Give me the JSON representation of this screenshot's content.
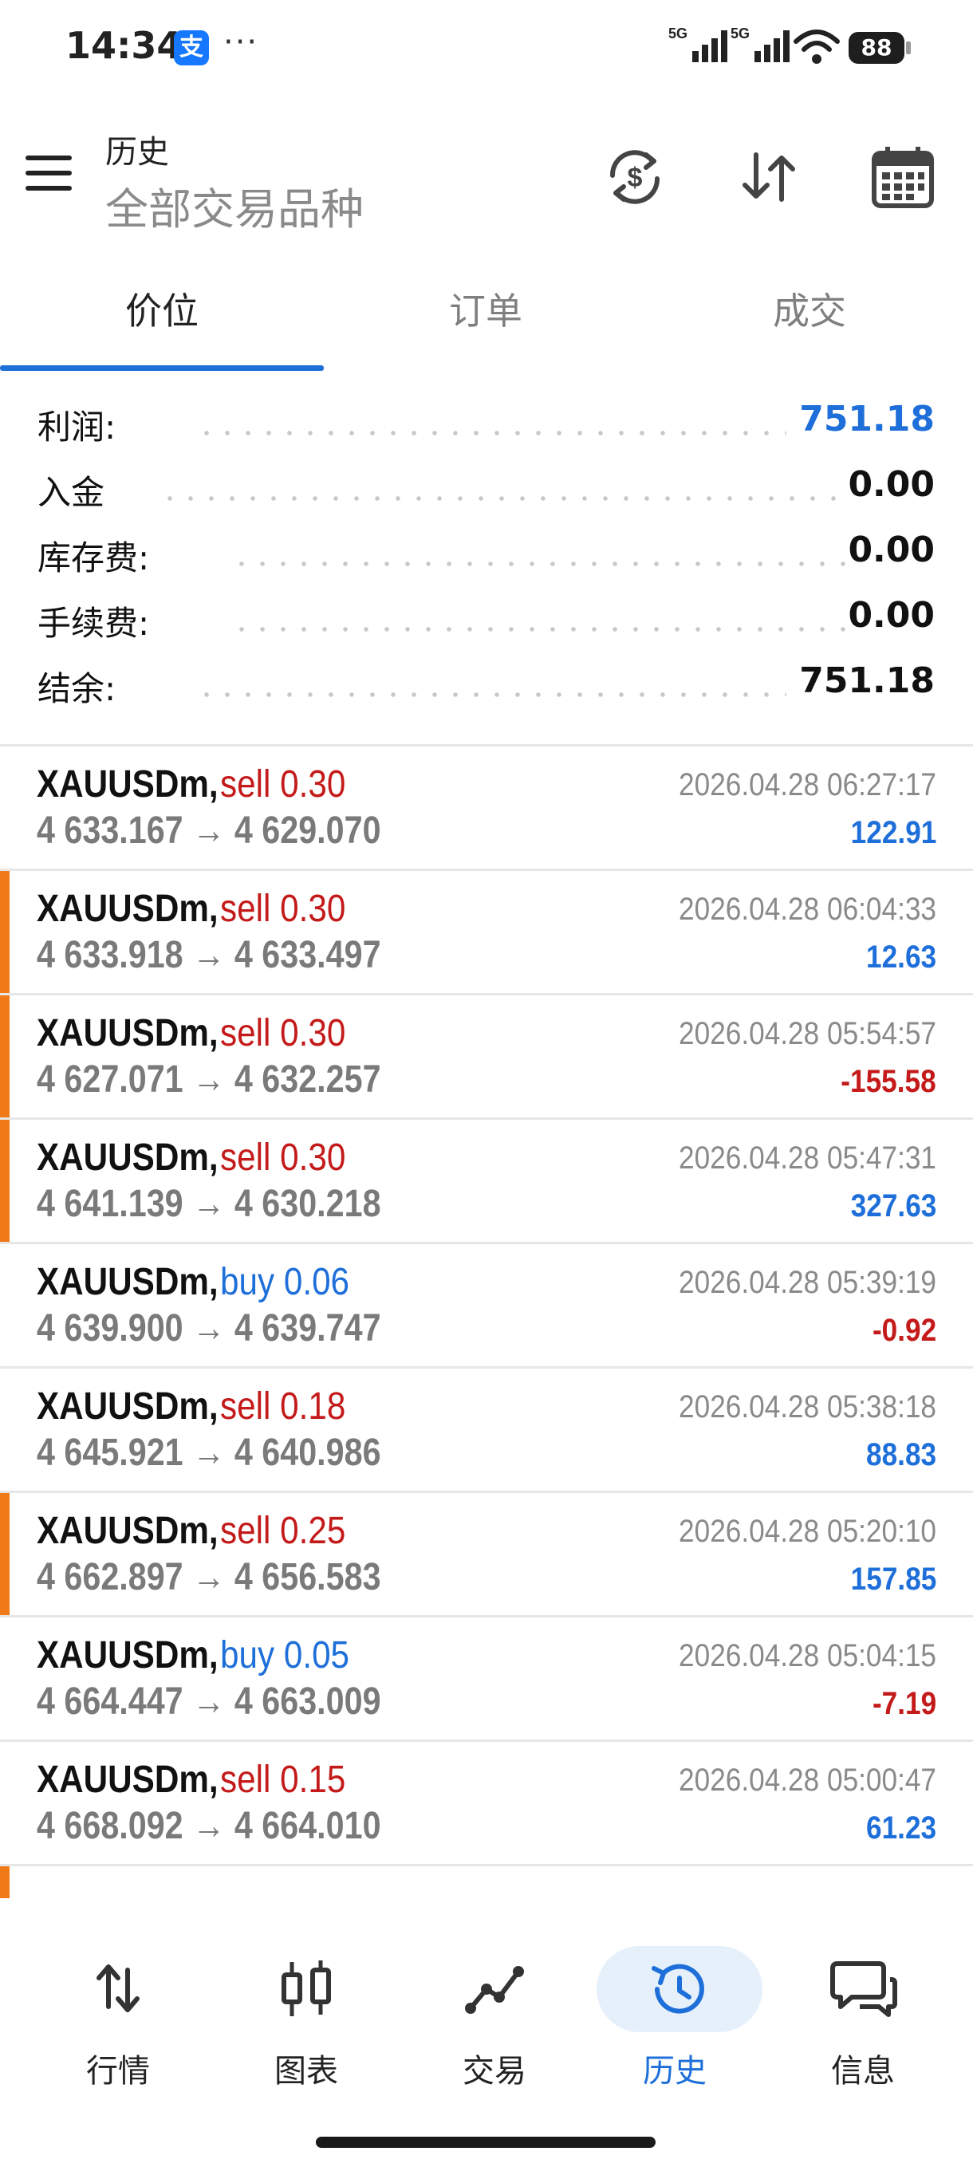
{
  "status_bar": {
    "time": "14:34",
    "alipay_icon_text": "支",
    "more": "···",
    "signal1": "5G",
    "signal2": "5G",
    "battery": "88"
  },
  "app_bar": {
    "title": "历史",
    "subtitle": "全部交易品种",
    "icons": [
      "menu-icon",
      "currency-sync-icon",
      "sort-icon",
      "calendar-icon"
    ]
  },
  "tabs": [
    {
      "label": "价位",
      "active": true
    },
    {
      "label": "订单",
      "active": false
    },
    {
      "label": "成交",
      "active": false
    }
  ],
  "summary": [
    {
      "label": "利润:",
      "value": "751.18",
      "highlight": true
    },
    {
      "label": "入金",
      "value": "0.00",
      "highlight": false
    },
    {
      "label": "库存费:",
      "value": "0.00",
      "highlight": false
    },
    {
      "label": "手续费:",
      "value": "0.00",
      "highlight": false
    },
    {
      "label": "结余:",
      "value": "751.18",
      "highlight": false
    }
  ],
  "trades": [
    {
      "symbol": "XAUUSDm,",
      "side": "sell 0.30",
      "type": "sell",
      "open": "4 633.167",
      "close": "4 629.070",
      "time": "2026.04.28 06:27:17",
      "profit": "122.91",
      "positive": true,
      "accent": false
    },
    {
      "symbol": "XAUUSDm,",
      "side": "sell 0.30",
      "type": "sell",
      "open": "4 633.918",
      "close": "4 633.497",
      "time": "2026.04.28 06:04:33",
      "profit": "12.63",
      "positive": true,
      "accent": true
    },
    {
      "symbol": "XAUUSDm,",
      "side": "sell 0.30",
      "type": "sell",
      "open": "4 627.071",
      "close": "4 632.257",
      "time": "2026.04.28 05:54:57",
      "profit": "-155.58",
      "positive": false,
      "accent": true
    },
    {
      "symbol": "XAUUSDm,",
      "side": "sell 0.30",
      "type": "sell",
      "open": "4 641.139",
      "close": "4 630.218",
      "time": "2026.04.28 05:47:31",
      "profit": "327.63",
      "positive": true,
      "accent": true
    },
    {
      "symbol": "XAUUSDm,",
      "side": "buy 0.06",
      "type": "buy",
      "open": "4 639.900",
      "close": "4 639.747",
      "time": "2026.04.28 05:39:19",
      "profit": "-0.92",
      "positive": false,
      "accent": false
    },
    {
      "symbol": "XAUUSDm,",
      "side": "sell 0.18",
      "type": "sell",
      "open": "4 645.921",
      "close": "4 640.986",
      "time": "2026.04.28 05:38:18",
      "profit": "88.83",
      "positive": true,
      "accent": false
    },
    {
      "symbol": "XAUUSDm,",
      "side": "sell 0.25",
      "type": "sell",
      "open": "4 662.897",
      "close": "4 656.583",
      "time": "2026.04.28 05:20:10",
      "profit": "157.85",
      "positive": true,
      "accent": true
    },
    {
      "symbol": "XAUUSDm,",
      "side": "buy 0.05",
      "type": "buy",
      "open": "4 664.447",
      "close": "4 663.009",
      "time": "2026.04.28 05:04:15",
      "profit": "-7.19",
      "positive": false,
      "accent": false
    },
    {
      "symbol": "XAUUSDm,",
      "side": "sell 0.15",
      "type": "sell",
      "open": "4 668.092",
      "close": "4 664.010",
      "time": "2026.04.28 05:00:47",
      "profit": "61.23",
      "positive": true,
      "accent": false
    }
  ],
  "arrow": "→",
  "bottom_nav": [
    {
      "label": "行情",
      "icon": "quotes-icon",
      "active": false
    },
    {
      "label": "图表",
      "icon": "chart-icon",
      "active": false
    },
    {
      "label": "交易",
      "icon": "trade-icon",
      "active": false
    },
    {
      "label": "历史",
      "icon": "history-icon",
      "active": true
    },
    {
      "label": "信息",
      "icon": "messages-icon",
      "active": false
    }
  ],
  "colors": {
    "accent_blue": "#1e6fd9",
    "sell_red": "#c41a1a",
    "position_accent_orange": "#f07a18",
    "muted_gray": "#8a8a8a"
  }
}
